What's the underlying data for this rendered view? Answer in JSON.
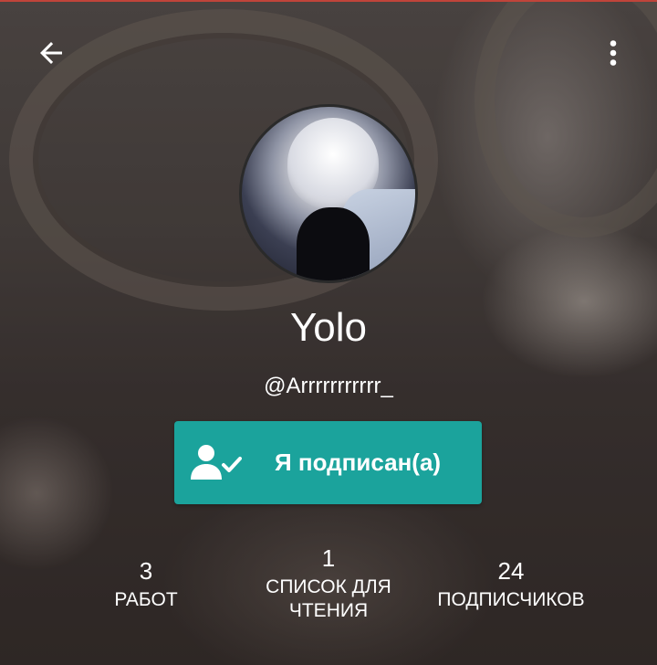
{
  "header": {
    "back_icon": "arrow-left-icon",
    "more_icon": "more-vertical-icon"
  },
  "profile": {
    "name": "Yolo",
    "handle": "@Arrrrrrrrrrr_",
    "avatar": "profile-photo"
  },
  "follow_button": {
    "label": "Я подписан(а)",
    "icon": "user-check-icon",
    "color": "#1ba39c"
  },
  "stats": {
    "works": {
      "value": "3",
      "label": "РАБОТ"
    },
    "reading_lists": {
      "value": "1",
      "label_line1": "СПИСОК ДЛЯ",
      "label_line2": "ЧТЕНИЯ"
    },
    "followers": {
      "value": "24",
      "label": "ПОДПИСЧИКОВ"
    }
  }
}
